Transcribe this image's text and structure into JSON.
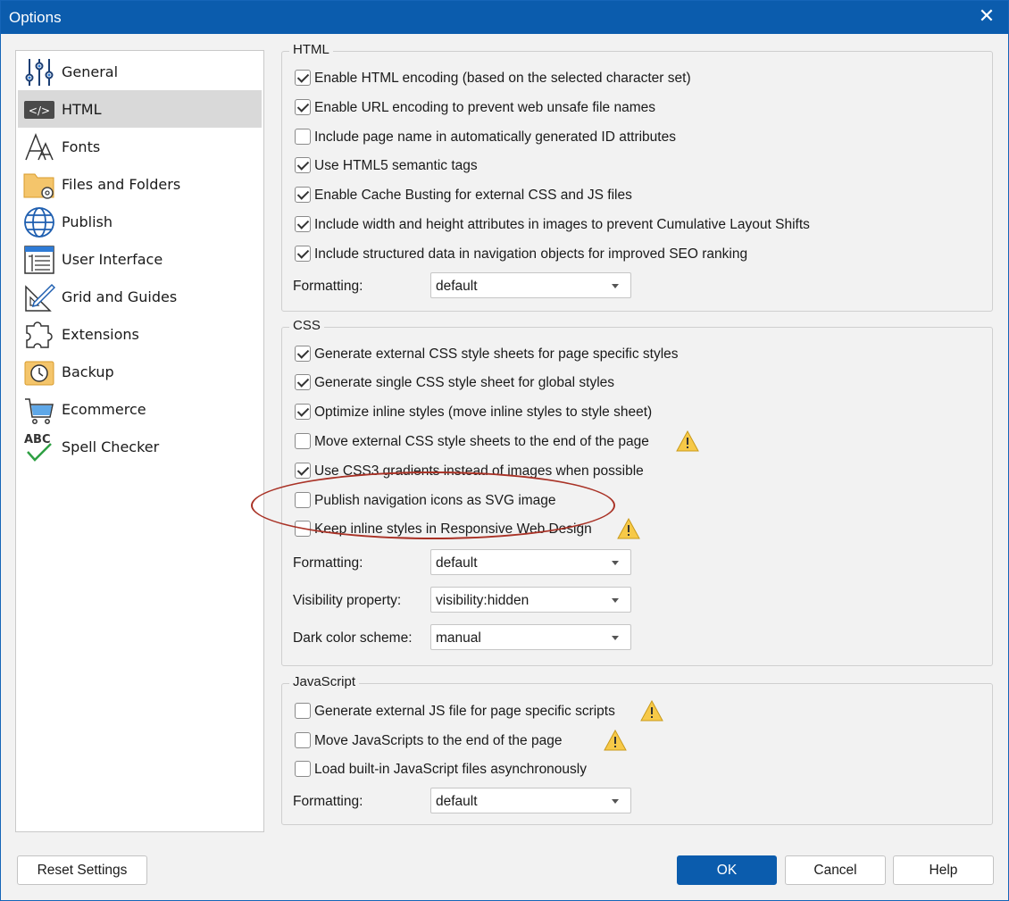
{
  "window": {
    "title": "Options"
  },
  "sidebar": {
    "items": [
      {
        "label": "General"
      },
      {
        "label": "HTML"
      },
      {
        "label": "Fonts"
      },
      {
        "label": "Files and Folders"
      },
      {
        "label": "Publish"
      },
      {
        "label": "User Interface"
      },
      {
        "label": "Grid and Guides"
      },
      {
        "label": "Extensions"
      },
      {
        "label": "Backup"
      },
      {
        "label": "Ecommerce"
      },
      {
        "label": "Spell Checker"
      }
    ],
    "active": "HTML"
  },
  "html_group": {
    "title": "HTML",
    "options": [
      {
        "label": "Enable HTML encoding (based on the selected character set)",
        "checked": true
      },
      {
        "label": "Enable URL encoding to prevent web unsafe file names",
        "checked": true
      },
      {
        "label": "Include page name in automatically generated ID attributes",
        "checked": false
      },
      {
        "label": "Use HTML5 semantic tags",
        "checked": true
      },
      {
        "label": "Enable Cache Busting for external CSS and JS files",
        "checked": true
      },
      {
        "label": "Include width and height attributes in images to prevent Cumulative Layout Shifts",
        "checked": true
      },
      {
        "label": "Include structured data in navigation objects for improved SEO ranking",
        "checked": true
      }
    ],
    "formatting_label": "Formatting:",
    "formatting_value": "default"
  },
  "css_group": {
    "title": "CSS",
    "options": [
      {
        "label": "Generate external CSS style sheets for page specific styles",
        "checked": true,
        "warning": false
      },
      {
        "label": "Generate single CSS style sheet for global styles",
        "checked": true,
        "warning": false
      },
      {
        "label": "Optimize inline styles (move inline styles to style sheet)",
        "checked": true,
        "warning": false
      },
      {
        "label": "Move external CSS style sheets to the end of the page",
        "checked": false,
        "warning": true
      },
      {
        "label": "Use CSS3 gradients instead of images when possible",
        "checked": true,
        "warning": false
      },
      {
        "label": "Publish navigation icons as SVG image",
        "checked": false,
        "warning": false
      },
      {
        "label": "Keep inline styles in Responsive Web Design",
        "checked": false,
        "warning": true
      }
    ],
    "formatting_label": "Formatting:",
    "formatting_value": "default",
    "visibility_label": "Visibility property:",
    "visibility_value": "visibility:hidden",
    "dark_label": "Dark color scheme:",
    "dark_value": "manual"
  },
  "js_group": {
    "title": "JavaScript",
    "options": [
      {
        "label": "Generate external JS file for page specific scripts",
        "checked": false,
        "warning": true
      },
      {
        "label": "Move JavaScripts to the end of the page",
        "checked": false,
        "warning": true
      },
      {
        "label": "Load built-in JavaScript files asynchronously",
        "checked": false,
        "warning": false
      }
    ],
    "formatting_label": "Formatting:",
    "formatting_value": "default"
  },
  "buttons": {
    "reset": "Reset Settings",
    "ok": "OK",
    "cancel": "Cancel",
    "help": "Help"
  },
  "colors": {
    "titlebar": "#0b5cad",
    "primary_button": "#0b5cad",
    "highlight_ellipse": "#a93226",
    "warning_fill": "#f7c948"
  }
}
